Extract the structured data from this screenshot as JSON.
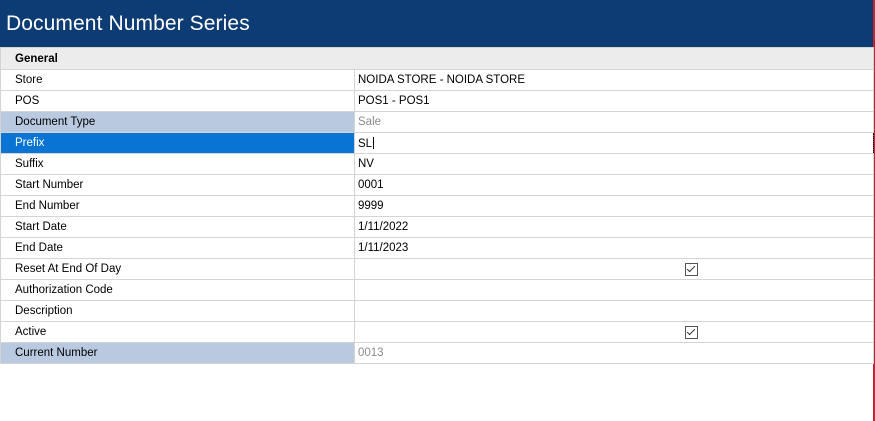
{
  "window": {
    "title": "Document Number Series"
  },
  "section": {
    "label": "General"
  },
  "rows": [
    {
      "label": "Store",
      "value": "NOIDA STORE - NOIDA STORE"
    },
    {
      "label": "POS",
      "value": "POS1 - POS1"
    },
    {
      "label": "Document Type",
      "value": "Sale",
      "readonly": true
    },
    {
      "label": "Prefix",
      "value": "SL",
      "selected": true
    },
    {
      "label": "Suffix",
      "value": "NV"
    },
    {
      "label": "Start Number",
      "value": "0001"
    },
    {
      "label": "End Number",
      "value": "9999"
    },
    {
      "label": "Start Date",
      "value": "1/11/2022"
    },
    {
      "label": "End Date",
      "value": "1/11/2023"
    },
    {
      "label": "Reset At End Of Day",
      "checked": true
    },
    {
      "label": "Authorization Code",
      "value": ""
    },
    {
      "label": "Description",
      "value": ""
    },
    {
      "label": "Active",
      "checked": true
    },
    {
      "label": "Current Number",
      "value": "0013",
      "readonly": true
    }
  ],
  "colors": {
    "title_bar": "#0d3c75",
    "selected_label": "#0a74d4",
    "readonly_label": "#b9c9e0",
    "accent_border": "#c0242c"
  }
}
